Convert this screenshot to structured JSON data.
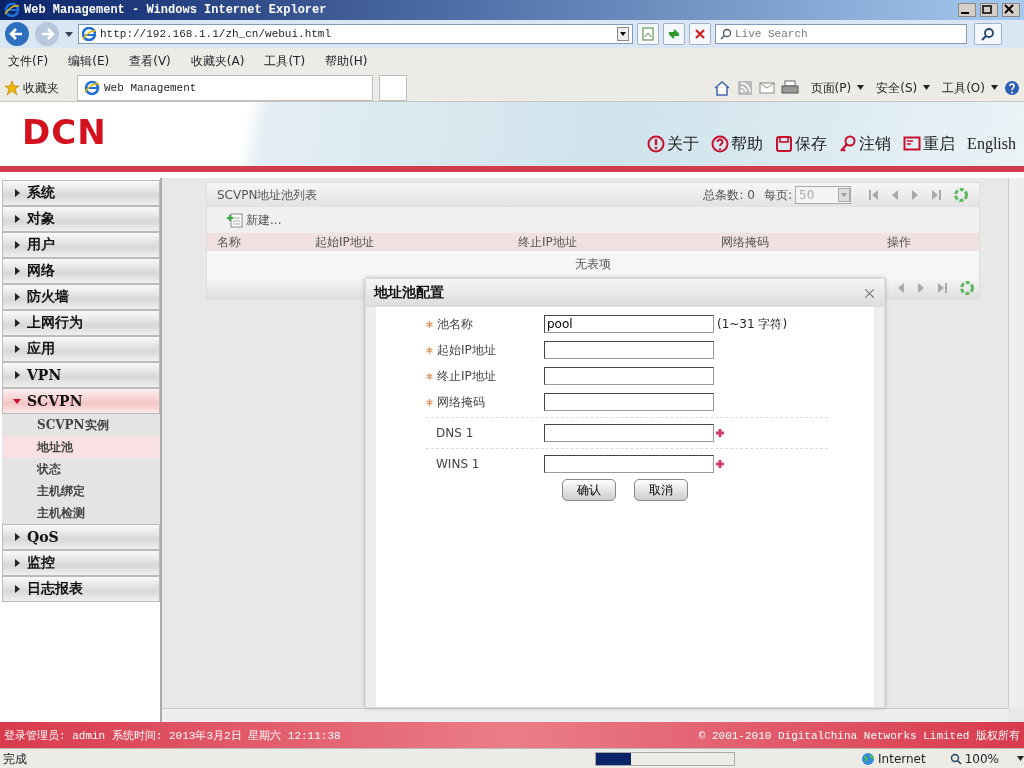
{
  "browser": {
    "title": "Web Management - Windows Internet Explorer",
    "address": "http://192.168.1.1/zh_cn/webui.html",
    "search_placeholder": "Live Search",
    "menu": [
      "文件(F)",
      "编辑(E)",
      "查看(V)",
      "收藏夹(A)",
      "工具(T)",
      "帮助(H)"
    ],
    "favorites": "收藏夹",
    "tab_title": "Web Management",
    "commands": [
      "页面(P)",
      "安全(S)",
      "工具(O)"
    ]
  },
  "header": {
    "logo": "DCN",
    "links": [
      {
        "kind": "about",
        "label": "关于"
      },
      {
        "kind": "help",
        "label": "帮助"
      },
      {
        "kind": "save",
        "label": "保存"
      },
      {
        "kind": "logout",
        "label": "注销"
      },
      {
        "kind": "reboot",
        "label": "重启"
      }
    ],
    "language": "English"
  },
  "sidebar": {
    "items": [
      {
        "label": "系统",
        "expanded": false
      },
      {
        "label": "对象",
        "expanded": false
      },
      {
        "label": "用户",
        "expanded": false
      },
      {
        "label": "网络",
        "expanded": false
      },
      {
        "label": "防火墙",
        "expanded": false
      },
      {
        "label": "上网行为",
        "expanded": false
      },
      {
        "label": "应用",
        "expanded": false
      },
      {
        "label": "VPN",
        "expanded": false
      },
      {
        "label": "SCVPN",
        "expanded": true,
        "children": [
          {
            "label": "SCVPN实例",
            "selected": false
          },
          {
            "label": "地址池",
            "selected": true
          },
          {
            "label": "状态",
            "selected": false
          },
          {
            "label": "主机绑定",
            "selected": false
          },
          {
            "label": "主机检测",
            "selected": false
          }
        ]
      },
      {
        "label": "QoS",
        "expanded": false
      },
      {
        "label": "监控",
        "expanded": false
      },
      {
        "label": "日志报表",
        "expanded": false
      }
    ]
  },
  "table": {
    "title": "SCVPN地址池列表",
    "total": "总条数: 0",
    "per_page_label": "每页:",
    "per_page": "50",
    "new_button": "新建...",
    "columns": [
      "名称",
      "起始IP地址",
      "终止IP地址",
      "网络掩码",
      "操作"
    ],
    "empty": "无表项"
  },
  "dialog": {
    "title": "地址池配置",
    "fields": [
      {
        "label": "池名称",
        "required": true,
        "kind": "text",
        "value": "pool",
        "hint": "(1~31 字符)"
      },
      {
        "label": "起始IP地址",
        "required": true,
        "kind": "text"
      },
      {
        "label": "终止IP地址",
        "required": true,
        "kind": "text"
      },
      {
        "label": "网络掩码",
        "required": true,
        "kind": "text"
      },
      {
        "label": "DNS 1",
        "required": false,
        "kind": "addable"
      },
      {
        "label": "WINS 1",
        "required": false,
        "kind": "addable"
      }
    ],
    "buttons": [
      "确认",
      "取消"
    ]
  },
  "footer": {
    "login": "登录管理员: admin 系统时间: 2013年3月2日 星期六 12:11:38",
    "copyright": "© 2001-2010 DigitalChina Networks Limited 版权所有"
  },
  "status_bar": {
    "text": "完成",
    "progress": {
      "level": 0.25
    },
    "zone": "Internet",
    "zoom": "100%"
  }
}
